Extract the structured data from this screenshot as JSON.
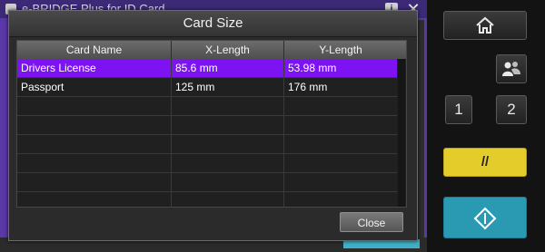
{
  "app": {
    "title": "e-BRIDGE Plus for ID Card",
    "info_icon": "i",
    "close_icon": "✕"
  },
  "dialog": {
    "title": "Card Size",
    "columns": [
      "Card Name",
      "X-Length",
      "Y-Length"
    ],
    "rows": [
      {
        "name": "Drivers License",
        "x": "85.6 mm",
        "y": "53.98 mm",
        "selected": true
      },
      {
        "name": "Passport",
        "x": "125 mm",
        "y": "176 mm",
        "selected": false
      }
    ],
    "close_label": "Close"
  },
  "panel": {
    "home_icon": "home-icon",
    "user_icon": "users-icon",
    "one_label": "1",
    "two_label": "2",
    "clear_label": "//",
    "start_icon": "start-icon"
  },
  "colors": {
    "selection": "#7d12f3",
    "clear_button": "#e4cc2a",
    "start_button": "#2a9ab3",
    "app_background": "#5b38a8"
  }
}
